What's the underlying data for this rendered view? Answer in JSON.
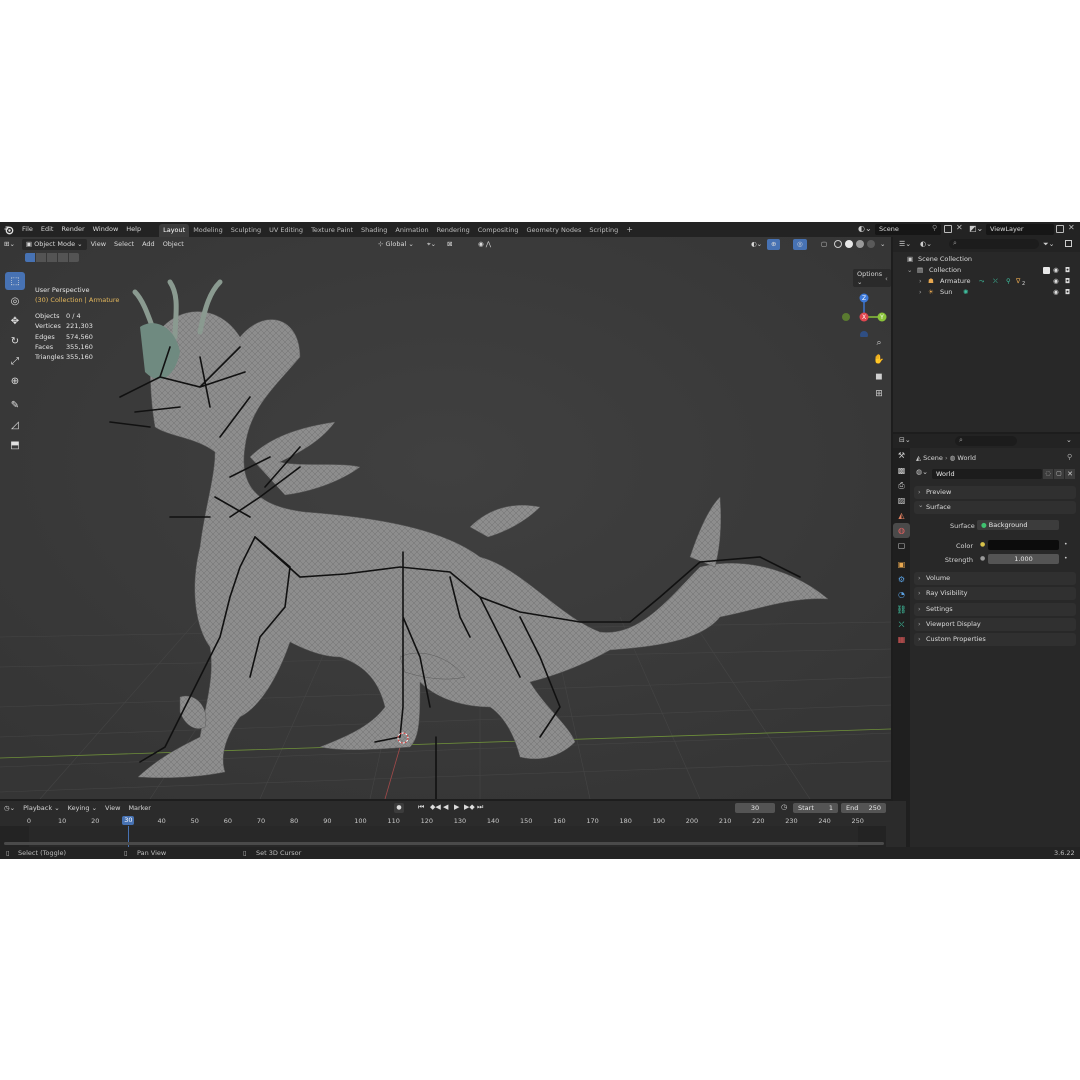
{
  "menu": {
    "items": [
      "File",
      "Edit",
      "Render",
      "Window",
      "Help"
    ]
  },
  "workspaces": {
    "tabs": [
      "Layout",
      "Modeling",
      "Sculpting",
      "UV Editing",
      "Texture Paint",
      "Shading",
      "Animation",
      "Rendering",
      "Compositing",
      "Geometry Nodes",
      "Scripting"
    ],
    "active": "Layout"
  },
  "scene": {
    "name": "Scene",
    "view_layer": "ViewLayer"
  },
  "viewport": {
    "mode": "Object Mode",
    "menus": [
      "View",
      "Select",
      "Add",
      "Object"
    ],
    "transform_orientation": "Global",
    "options_label": "Options",
    "perspective": "User Perspective",
    "collection_prefix": "(30) Collection | ",
    "collection_object": "Armature",
    "stats": [
      {
        "label": "Objects",
        "value": "0 / 4"
      },
      {
        "label": "Vertices",
        "value": "221,303"
      },
      {
        "label": "Edges",
        "value": "574,560"
      },
      {
        "label": "Faces",
        "value": "355,160"
      },
      {
        "label": "Triangles",
        "value": "355,160"
      }
    ],
    "gizmo": {
      "x": "X",
      "y": "Y",
      "z": "Z"
    }
  },
  "outliner": {
    "root": "Scene Collection",
    "collection": "Collection",
    "objects": [
      "Armature",
      "Sun"
    ],
    "armature_suffix": "2"
  },
  "properties": {
    "breadcrumb": [
      "Scene",
      "World"
    ],
    "world_name": "World",
    "panels": {
      "preview": "Preview",
      "surface": "Surface",
      "volume": "Volume",
      "ray_visibility": "Ray Visibility",
      "settings": "Settings",
      "viewport_display": "Viewport Display",
      "custom_properties": "Custom Properties"
    },
    "surface_label": "Surface",
    "surface_value": "Background",
    "color_label": "Color",
    "strength_label": "Strength",
    "strength_value": "1.000"
  },
  "timeline": {
    "menus": [
      "Playback",
      "Keying",
      "View",
      "Marker"
    ],
    "current_frame": "30",
    "start_label": "Start",
    "start_value": "1",
    "end_label": "End",
    "end_value": "250",
    "ticks": [
      "0",
      "10",
      "20",
      "30",
      "40",
      "50",
      "60",
      "70",
      "80",
      "90",
      "100",
      "110",
      "120",
      "130",
      "140",
      "150",
      "160",
      "170",
      "180",
      "190",
      "200",
      "210",
      "220",
      "230",
      "240",
      "250"
    ]
  },
  "statusbar": {
    "select": "Select (Toggle)",
    "pan": "Pan View",
    "cursor": "Set 3D Cursor",
    "version": "3.6.22"
  },
  "colors": {
    "accent": "#4772b3",
    "viewport_bg": "#3a3a3a",
    "panel_bg": "#282828",
    "x_axis": "#e0464f",
    "y_axis": "#8ac33a",
    "z_axis": "#3d79d8",
    "active_text": "#e5b85c"
  }
}
